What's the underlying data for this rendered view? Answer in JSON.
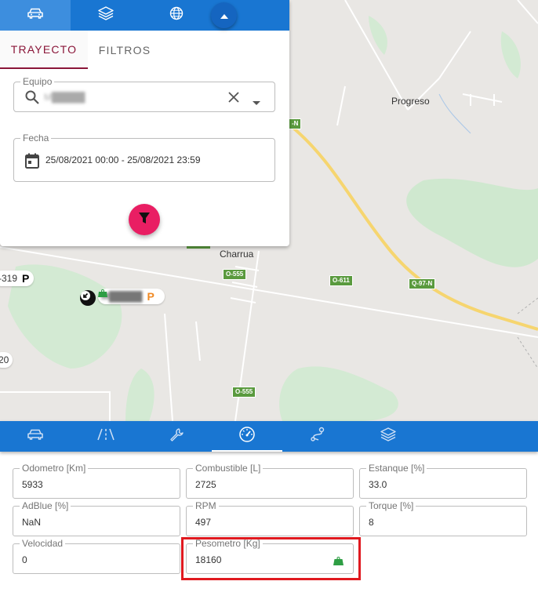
{
  "top_tabs": [
    {
      "icon": "car-icon"
    },
    {
      "icon": "layers-icon"
    },
    {
      "icon": "globe-icon"
    }
  ],
  "panel": {
    "tabs": [
      "TRAYECTO",
      "FILTROS"
    ],
    "equipo": {
      "label": "Equipo",
      "value": "M█████"
    },
    "fecha": {
      "label": "Fecha",
      "value": "25/08/2021 00:00 - 25/08/2021 23:59"
    }
  },
  "map": {
    "places": [
      "Progreso",
      "Charrua"
    ],
    "roads": [
      "-N",
      "O-555",
      "O-611",
      "Q-97-N",
      "O-555"
    ],
    "edge_labels": [
      "-319",
      "20"
    ],
    "marker_label": "M█████",
    "parking_letter": "P",
    "accent_colors": {
      "route": "#f6d56f",
      "parking": "#f08a24",
      "weight": "#2e9e44"
    }
  },
  "bottom_tabs": [
    {
      "icon": "car-icon"
    },
    {
      "icon": "road-icon"
    },
    {
      "icon": "wrench-icon"
    },
    {
      "icon": "gauge-icon",
      "active": true
    },
    {
      "icon": "route-icon"
    },
    {
      "icon": "layers-icon"
    }
  ],
  "metrics": {
    "odometro": {
      "label": "Odometro [Km]",
      "value": "5933"
    },
    "combustible": {
      "label": "Combustible [L]",
      "value": "2725"
    },
    "estanque": {
      "label": "Estanque [%]",
      "value": "33.0"
    },
    "adblue": {
      "label": "AdBlue [%]",
      "value": "NaN"
    },
    "rpm": {
      "label": "RPM",
      "value": "497"
    },
    "torque": {
      "label": "Torque [%]",
      "value": "8"
    },
    "velocidad": {
      "label": "Velocidad",
      "value": "0"
    },
    "pesometro": {
      "label": "Pesometro [Kg]",
      "value": "18160"
    }
  },
  "colors": {
    "primary": "#1976d2",
    "accent": "#8a1538",
    "fab": "#e91e63",
    "highlight": "#e0191f"
  }
}
